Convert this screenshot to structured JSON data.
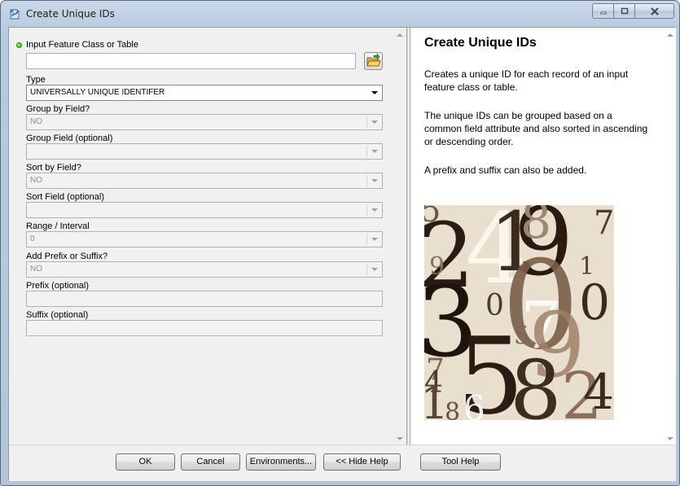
{
  "window": {
    "title": "Create Unique IDs",
    "controls": {
      "minimize": "−",
      "maximize": "□",
      "close": "✕"
    }
  },
  "form": {
    "input_feature_label": "Input Feature Class or Table",
    "input_feature_value": "",
    "type_label": "Type",
    "type_value": "UNIVERSALLY UNIQUE IDENTIFER",
    "group_by_label": "Group by Field?",
    "group_by_value": "NO",
    "group_field_label": "Group Field (optional)",
    "group_field_value": "",
    "sort_by_label": "Sort by Field?",
    "sort_by_value": "NO",
    "sort_field_label": "Sort Field (optional)",
    "sort_field_value": "",
    "range_label": "Range / Interval",
    "range_value": "0",
    "add_prefix_label": "Add Prefix or Suffix?",
    "add_prefix_value": "NO",
    "prefix_label": "Prefix (optional)",
    "prefix_value": "",
    "suffix_label": "Suffix (optional)",
    "suffix_value": ""
  },
  "help": {
    "title": "Create Unique IDs",
    "p1": "Creates a unique ID for each record of an input feature class or table.",
    "p2": "The unique IDs can be grouped based on a common field attribute and also sorted in ascending or descending order.",
    "p3": "A prefix and suffix can also be added."
  },
  "buttons": {
    "ok": "OK",
    "cancel": "Cancel",
    "environments": "Environments...",
    "hide_help": "<< Hide Help",
    "tool_help": "Tool Help"
  },
  "icons": {
    "app": "geoprocessing-tool-icon",
    "browse": "open-folder-icon"
  },
  "colors": {
    "required_dot": "#1fb000",
    "help_bg": "#ffffff",
    "panel_bg": "#f0f0f0"
  }
}
